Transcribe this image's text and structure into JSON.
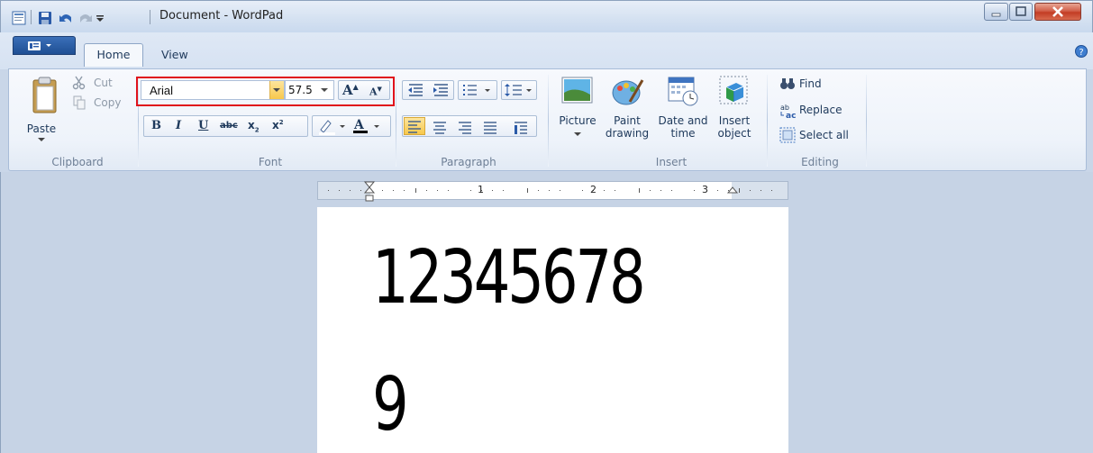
{
  "window": {
    "title": "Document - WordPad",
    "qat": [
      "wordpad-icon",
      "save-icon",
      "undo-icon",
      "redo-icon",
      "customize-icon"
    ]
  },
  "tabs": [
    {
      "label": "Home",
      "active": true
    },
    {
      "label": "View",
      "active": false
    }
  ],
  "clipboard": {
    "paste": "Paste",
    "cut": "Cut",
    "copy": "Copy",
    "group": "Clipboard"
  },
  "font": {
    "name": "Arial",
    "size": "57.5",
    "group": "Font"
  },
  "paragraph": {
    "group": "Paragraph"
  },
  "insert": {
    "picture": "Picture",
    "paint_1": "Paint",
    "paint_2": "drawing",
    "date_1": "Date and",
    "date_2": "time",
    "object_1": "Insert",
    "object_2": "object",
    "group": "Insert"
  },
  "editing": {
    "find": "Find",
    "replace": "Replace",
    "select_all": "Select all",
    "group": "Editing"
  },
  "ruler": {
    "marks": [
      "1",
      "2",
      "3"
    ]
  },
  "document": {
    "line1": "12345678",
    "line2": "9"
  },
  "colors": {
    "highlight": "#e0121b",
    "ribbon": "#eef3fa",
    "workspace": "#c6d3e5"
  }
}
